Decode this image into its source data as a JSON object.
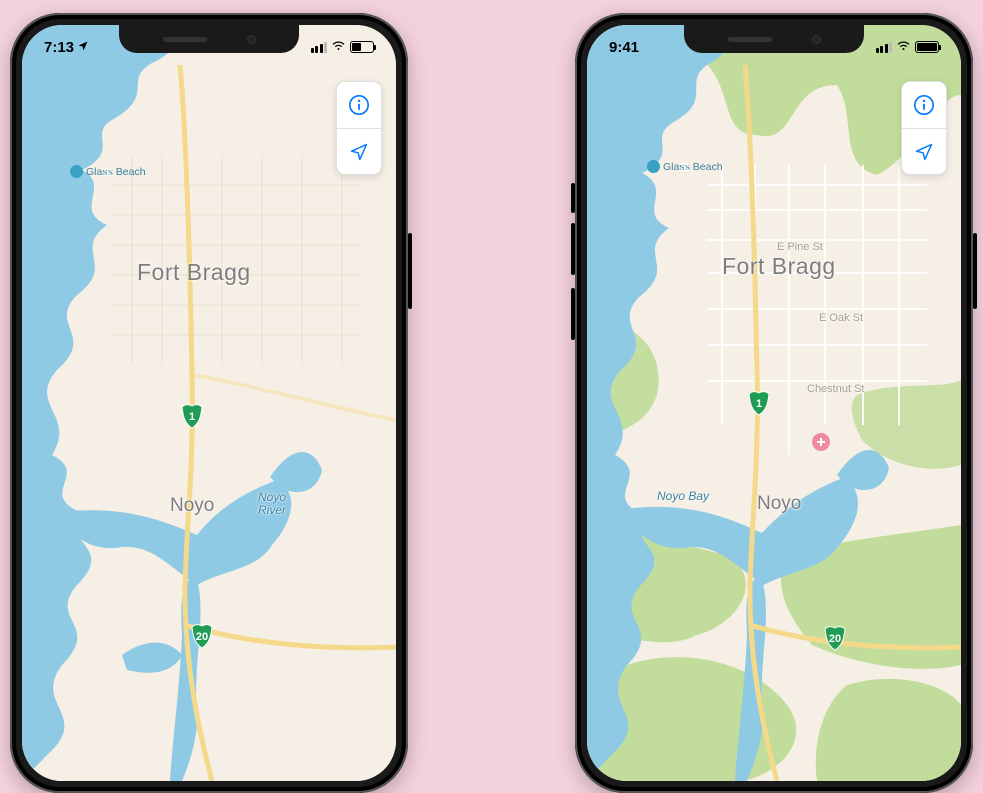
{
  "phones": {
    "left": {
      "status": {
        "time": "7:13",
        "has_location_arrow": true,
        "battery_level": "low"
      },
      "map": {
        "city_primary": "Fort Bragg",
        "city_secondary": "Noyo",
        "water_river": "Noyo\nRiver",
        "poi_beach": "Glass Beach",
        "highways": {
          "hwy1": "1",
          "hwy20": "20"
        }
      }
    },
    "right": {
      "status": {
        "time": "9:41",
        "has_location_arrow": false,
        "battery_level": "full"
      },
      "map": {
        "city_primary": "Fort Bragg",
        "city_secondary": "Noyo",
        "water_bay": "Noyo Bay",
        "poi_beach": "Glass Beach",
        "streets": {
          "pine": "E Pine St",
          "oak": "E Oak St",
          "chestnut": "Chestnut St"
        },
        "highways": {
          "hwy1": "1",
          "hwy20": "20"
        }
      }
    }
  },
  "controls": {
    "info": "info",
    "locate": "locate"
  },
  "colors": {
    "water": "#8fcae5",
    "land": "#f5efe5",
    "vegetation": "#b8d98e",
    "highway_shield": "#1f9d55",
    "ios_blue": "#007aff"
  }
}
